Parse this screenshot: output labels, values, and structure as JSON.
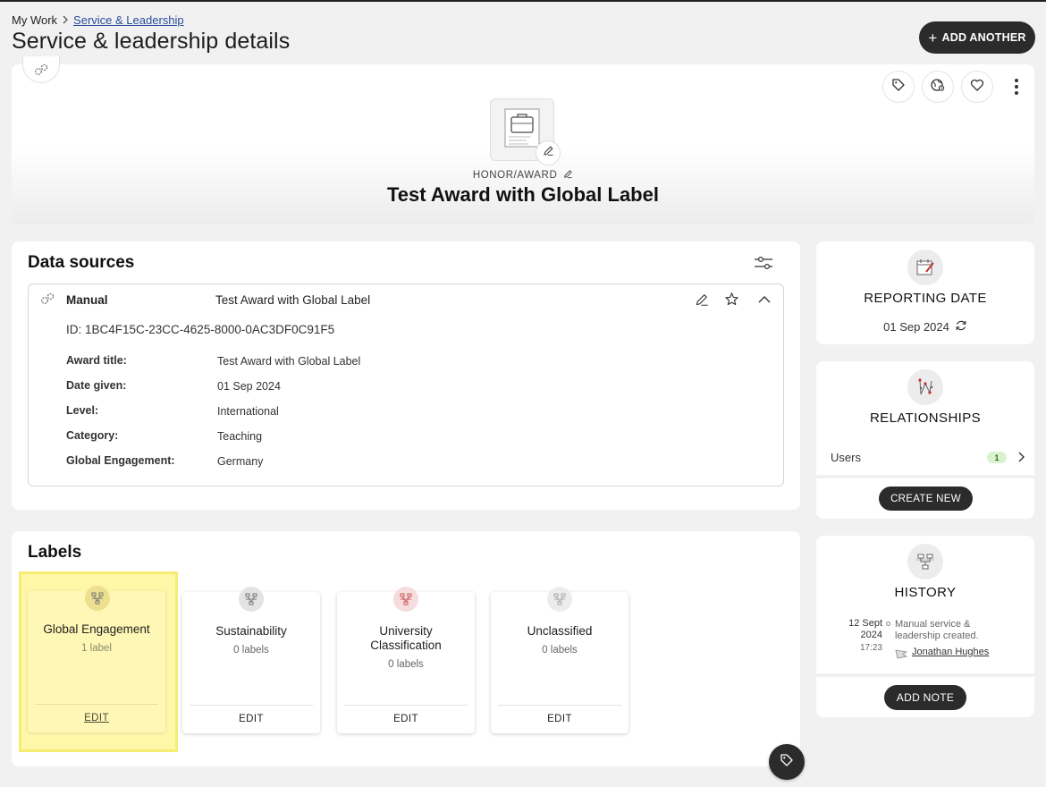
{
  "breadcrumb": {
    "root": "My Work",
    "current": "Service & Leadership"
  },
  "page": {
    "title": "Service & leadership details"
  },
  "toolbar": {
    "add_another_label": "ADD ANOTHER"
  },
  "hero": {
    "type_label": "HONOR/AWARD",
    "title": "Test Award with Global Label",
    "actions": [
      {
        "icon": "tag-icon"
      },
      {
        "icon": "globe-icon"
      },
      {
        "icon": "heart-icon"
      },
      {
        "icon": "more-options-icon"
      }
    ]
  },
  "data_sources": {
    "title": "Data sources",
    "source": {
      "name": "Manual",
      "heading": "Test Award with Global Label",
      "id_text": "ID: 1BC4F15C-23CC-4625-8000-0AC3DF0C91F5",
      "fields": [
        {
          "label": "Award title:",
          "value": "Test Award with Global Label"
        },
        {
          "label": "Date given:",
          "value": "01 Sep 2024"
        },
        {
          "label": "Level:",
          "value": "International"
        },
        {
          "label": "Category:",
          "value": "Teaching"
        },
        {
          "label": "Global Engagement:",
          "value": "Germany"
        }
      ]
    }
  },
  "labels": {
    "title": "Labels",
    "cards": [
      {
        "name": "Global Engagement",
        "count": "1 label",
        "edit": "EDIT",
        "highlighted": true
      },
      {
        "name": "Sustainability",
        "count": "0 labels",
        "edit": "EDIT"
      },
      {
        "name": "University Classification",
        "count": "0 labels",
        "edit": "EDIT"
      },
      {
        "name": "Unclassified",
        "count": "0 labels",
        "edit": "EDIT"
      }
    ]
  },
  "reporting_date": {
    "heading": "REPORTING DATE",
    "value": "01 Sep 2024"
  },
  "relationships": {
    "heading": "RELATIONSHIPS",
    "users_label": "Users",
    "users_count": "1",
    "create_new_label": "CREATE NEW"
  },
  "history": {
    "heading": "HISTORY",
    "entry": {
      "date": "12 Sept 2024",
      "time": "17:23",
      "text": "Manual service & leadership created.",
      "user": "Jonathan Hughes"
    },
    "add_note_label": "ADD NOTE"
  },
  "colors": {
    "dark_button": "#2b2b2b",
    "highlight": "#fff7a8",
    "badge_bg": "#d9f3cf",
    "link": "#2a4d9b"
  }
}
